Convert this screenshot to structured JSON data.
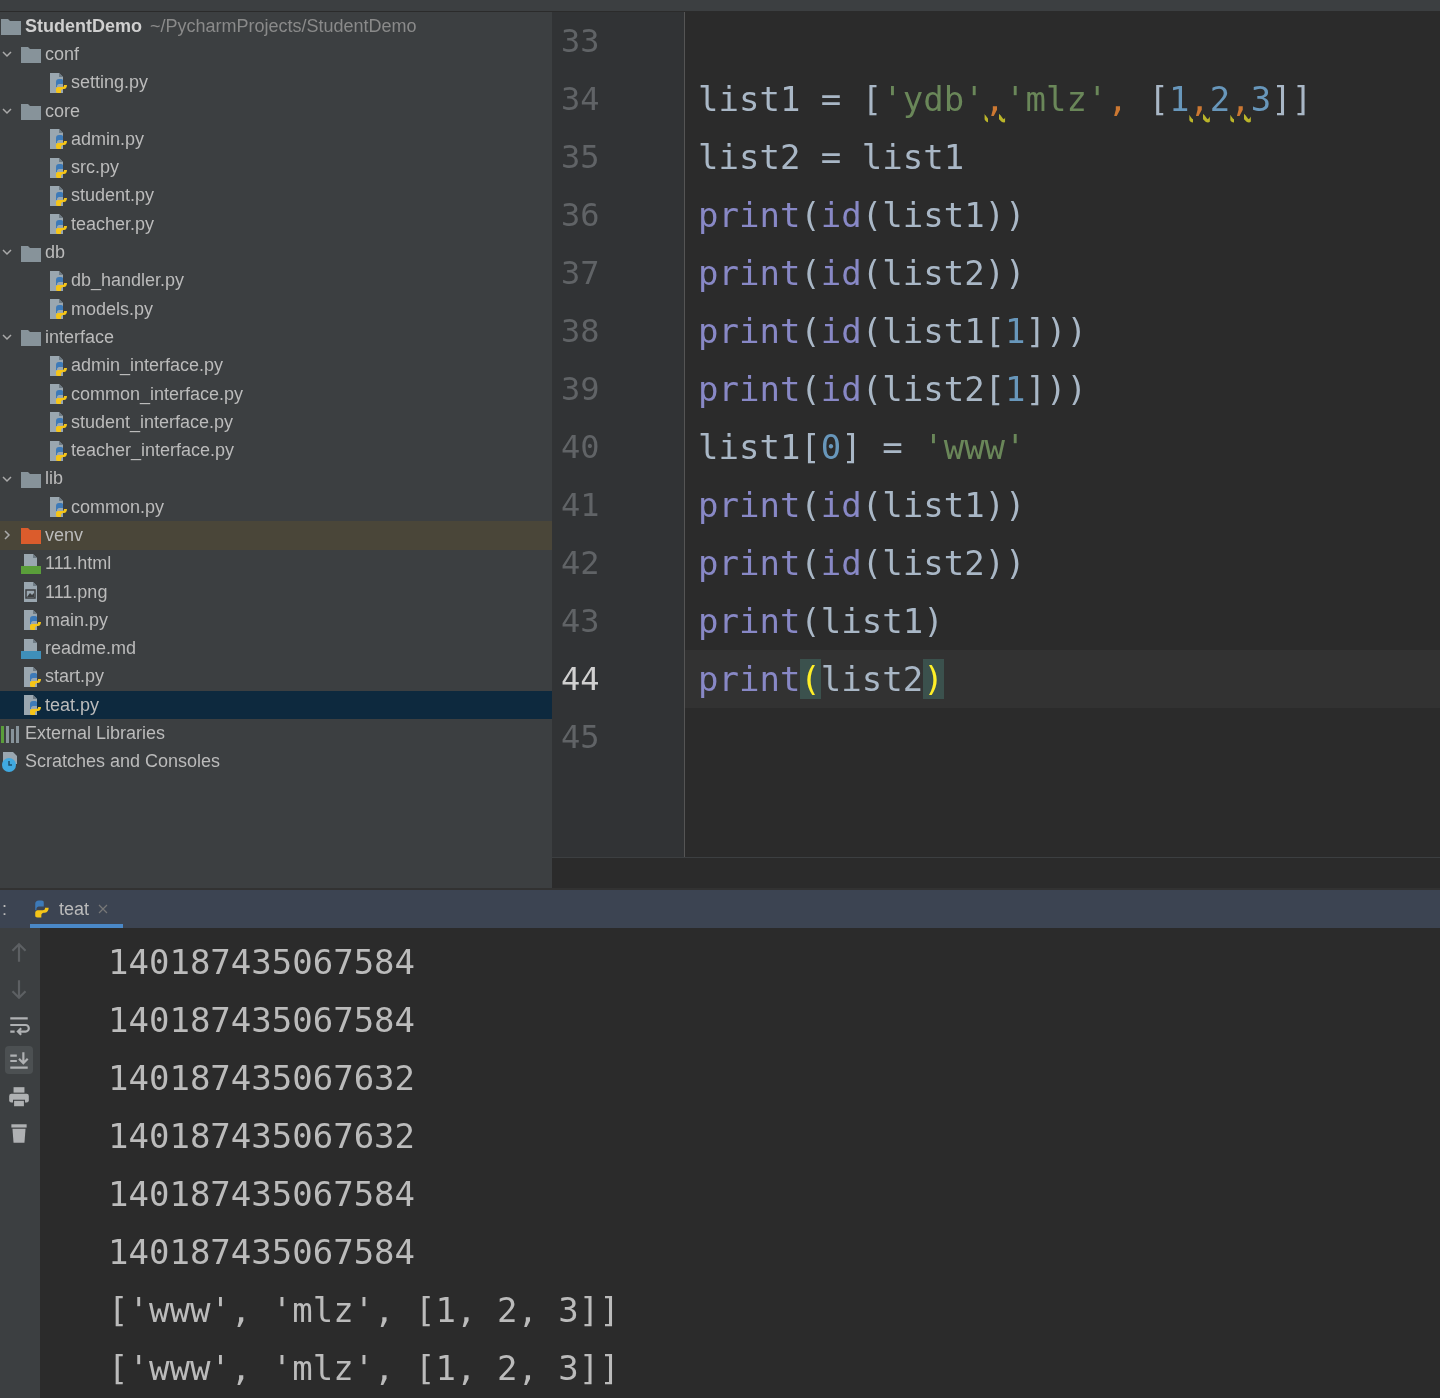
{
  "project_tree": {
    "root": {
      "label": "StudentDemo",
      "path": "~/PycharmProjects/StudentDemo",
      "kind": "project"
    },
    "items": [
      {
        "label": "conf",
        "kind": "folder",
        "expanded": true,
        "selected": false,
        "children": [
          {
            "label": "setting.py",
            "kind": "py",
            "selected": false
          }
        ]
      },
      {
        "label": "core",
        "kind": "folder",
        "expanded": true,
        "selected": false,
        "children": [
          {
            "label": "admin.py",
            "kind": "py",
            "selected": false
          },
          {
            "label": "src.py",
            "kind": "py",
            "selected": false
          },
          {
            "label": "student.py",
            "kind": "py",
            "selected": false
          },
          {
            "label": "teacher.py",
            "kind": "py",
            "selected": false
          }
        ]
      },
      {
        "label": "db",
        "kind": "folder",
        "expanded": true,
        "selected": false,
        "children": [
          {
            "label": "db_handler.py",
            "kind": "py",
            "selected": false
          },
          {
            "label": "models.py",
            "kind": "py",
            "selected": false
          }
        ]
      },
      {
        "label": "interface",
        "kind": "folder",
        "expanded": true,
        "selected": false,
        "children": [
          {
            "label": "admin_interface.py",
            "kind": "py",
            "selected": false
          },
          {
            "label": "common_interface.py",
            "kind": "py",
            "selected": false
          },
          {
            "label": "student_interface.py",
            "kind": "py",
            "selected": false
          },
          {
            "label": "teacher_interface.py",
            "kind": "py",
            "selected": false
          }
        ]
      },
      {
        "label": "lib",
        "kind": "folder",
        "expanded": true,
        "selected": false,
        "children": [
          {
            "label": "common.py",
            "kind": "py",
            "selected": false
          }
        ]
      },
      {
        "label": "venv",
        "kind": "excluded_folder",
        "expanded": false,
        "selected": false
      },
      {
        "label": "111.html",
        "kind": "html",
        "selected": false
      },
      {
        "label": "111.png",
        "kind": "png",
        "selected": false
      },
      {
        "label": "main.py",
        "kind": "py",
        "selected": false
      },
      {
        "label": "readme.md",
        "kind": "md",
        "selected": false
      },
      {
        "label": "start.py",
        "kind": "py",
        "selected": false
      },
      {
        "label": "teat.py",
        "kind": "py",
        "selected": true
      }
    ],
    "extras": [
      {
        "label": "External Libraries",
        "kind": "libraries"
      },
      {
        "label": "Scratches and Consoles",
        "kind": "scratches"
      }
    ]
  },
  "editor": {
    "lines": [
      {
        "number": "33",
        "current": false
      },
      {
        "number": "34",
        "current": false,
        "tokens": [
          {
            "text": "list1 = [",
            "kind": "plain"
          },
          {
            "text": "'ydb'",
            "kind": "string"
          },
          {
            "text": ",",
            "kind": "flagged"
          },
          {
            "text": "'mlz'",
            "kind": "string"
          },
          {
            "text": ",",
            "kind": "keyword"
          },
          {
            "text": " [",
            "kind": "plain"
          },
          {
            "text": "1",
            "kind": "number"
          },
          {
            "text": ",",
            "kind": "flagged"
          },
          {
            "text": "2",
            "kind": "number"
          },
          {
            "text": ",",
            "kind": "flagged"
          },
          {
            "text": "3",
            "kind": "number"
          },
          {
            "text": "]]",
            "kind": "plain"
          }
        ]
      },
      {
        "number": "35",
        "current": false,
        "tokens": [
          {
            "text": "list2 = list1",
            "kind": "plain"
          }
        ]
      },
      {
        "number": "36",
        "current": false,
        "tokens": [
          {
            "text": "print",
            "kind": "builtin"
          },
          {
            "text": "(",
            "kind": "plain"
          },
          {
            "text": "id",
            "kind": "builtin"
          },
          {
            "text": "(list1))",
            "kind": "plain"
          }
        ]
      },
      {
        "number": "37",
        "current": false,
        "tokens": [
          {
            "text": "print",
            "kind": "builtin"
          },
          {
            "text": "(",
            "kind": "plain"
          },
          {
            "text": "id",
            "kind": "builtin"
          },
          {
            "text": "(list2))",
            "kind": "plain"
          }
        ]
      },
      {
        "number": "38",
        "current": false,
        "tokens": [
          {
            "text": "print",
            "kind": "builtin"
          },
          {
            "text": "(",
            "kind": "plain"
          },
          {
            "text": "id",
            "kind": "builtin"
          },
          {
            "text": "(list1[",
            "kind": "plain"
          },
          {
            "text": "1",
            "kind": "number"
          },
          {
            "text": "]))",
            "kind": "plain"
          }
        ]
      },
      {
        "number": "39",
        "current": false,
        "tokens": [
          {
            "text": "print",
            "kind": "builtin"
          },
          {
            "text": "(",
            "kind": "plain"
          },
          {
            "text": "id",
            "kind": "builtin"
          },
          {
            "text": "(list2[",
            "kind": "plain"
          },
          {
            "text": "1",
            "kind": "number"
          },
          {
            "text": "]))",
            "kind": "plain"
          }
        ]
      },
      {
        "number": "40",
        "current": false,
        "tokens": [
          {
            "text": "list1[",
            "kind": "plain"
          },
          {
            "text": "0",
            "kind": "number"
          },
          {
            "text": "] = ",
            "kind": "plain"
          },
          {
            "text": "'www'",
            "kind": "string"
          }
        ]
      },
      {
        "number": "41",
        "current": false,
        "tokens": [
          {
            "text": "print",
            "kind": "builtin"
          },
          {
            "text": "(",
            "kind": "plain"
          },
          {
            "text": "id",
            "kind": "builtin"
          },
          {
            "text": "(list1))",
            "kind": "plain"
          }
        ]
      },
      {
        "number": "42",
        "current": false,
        "tokens": [
          {
            "text": "print",
            "kind": "builtin"
          },
          {
            "text": "(",
            "kind": "plain"
          },
          {
            "text": "id",
            "kind": "builtin"
          },
          {
            "text": "(list2))",
            "kind": "plain"
          }
        ]
      },
      {
        "number": "43",
        "current": false,
        "tokens": [
          {
            "text": "print",
            "kind": "builtin"
          },
          {
            "text": "(list1)",
            "kind": "plain"
          }
        ]
      },
      {
        "number": "44",
        "current": true,
        "tokens": [
          {
            "text": "print",
            "kind": "builtin"
          },
          {
            "text": "(",
            "kind": "matched"
          },
          {
            "text": "list2",
            "kind": "plain"
          },
          {
            "text": ")",
            "kind": "matched"
          }
        ]
      },
      {
        "number": "45",
        "current": false
      }
    ]
  },
  "run_panel": {
    "label": ":",
    "tabs": [
      {
        "label": "teat",
        "selected": true
      }
    ],
    "toolbar": [
      {
        "kind": "up",
        "on": false
      },
      {
        "kind": "down",
        "on": false
      },
      {
        "kind": "wrap",
        "on": false
      },
      {
        "kind": "scroll_end",
        "on": true
      },
      {
        "kind": "print",
        "on": false
      },
      {
        "kind": "trash",
        "on": false
      }
    ],
    "output": [
      "140187435067584",
      "140187435067584",
      "140187435067632",
      "140187435067632",
      "140187435067584",
      "140187435067584",
      "['www', 'mlz', [1, 2, 3]]",
      "['www', 'mlz', [1, 2, 3]]"
    ]
  }
}
